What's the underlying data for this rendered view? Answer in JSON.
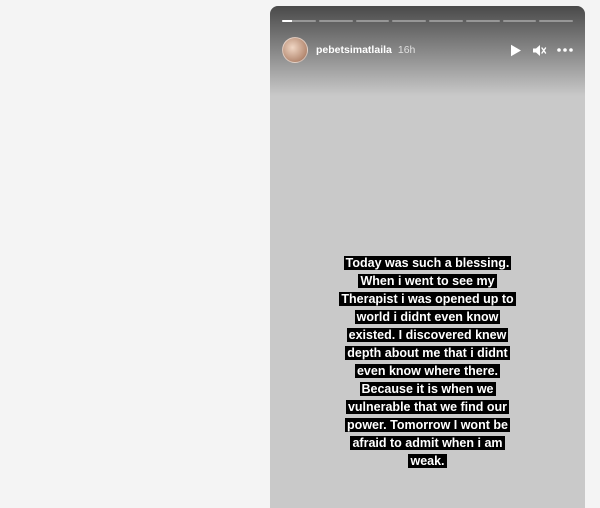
{
  "story": {
    "username": "pebetsimatlaila",
    "time_ago": "16h",
    "progress": [
      0.3,
      0,
      0,
      0,
      0,
      0,
      0,
      0
    ],
    "caption": "Today was such a blessing. When i went to see my Therapist i was opened up to world i didnt even know existed. I discovered knew depth about me that i didnt even know where there. Because it is when we vulnerable that we find our power. Tomorrow I wont be afraid to admit when i am weak."
  },
  "icons": {
    "play": "play-icon",
    "volume": "volume-icon",
    "more": "more-icon"
  }
}
